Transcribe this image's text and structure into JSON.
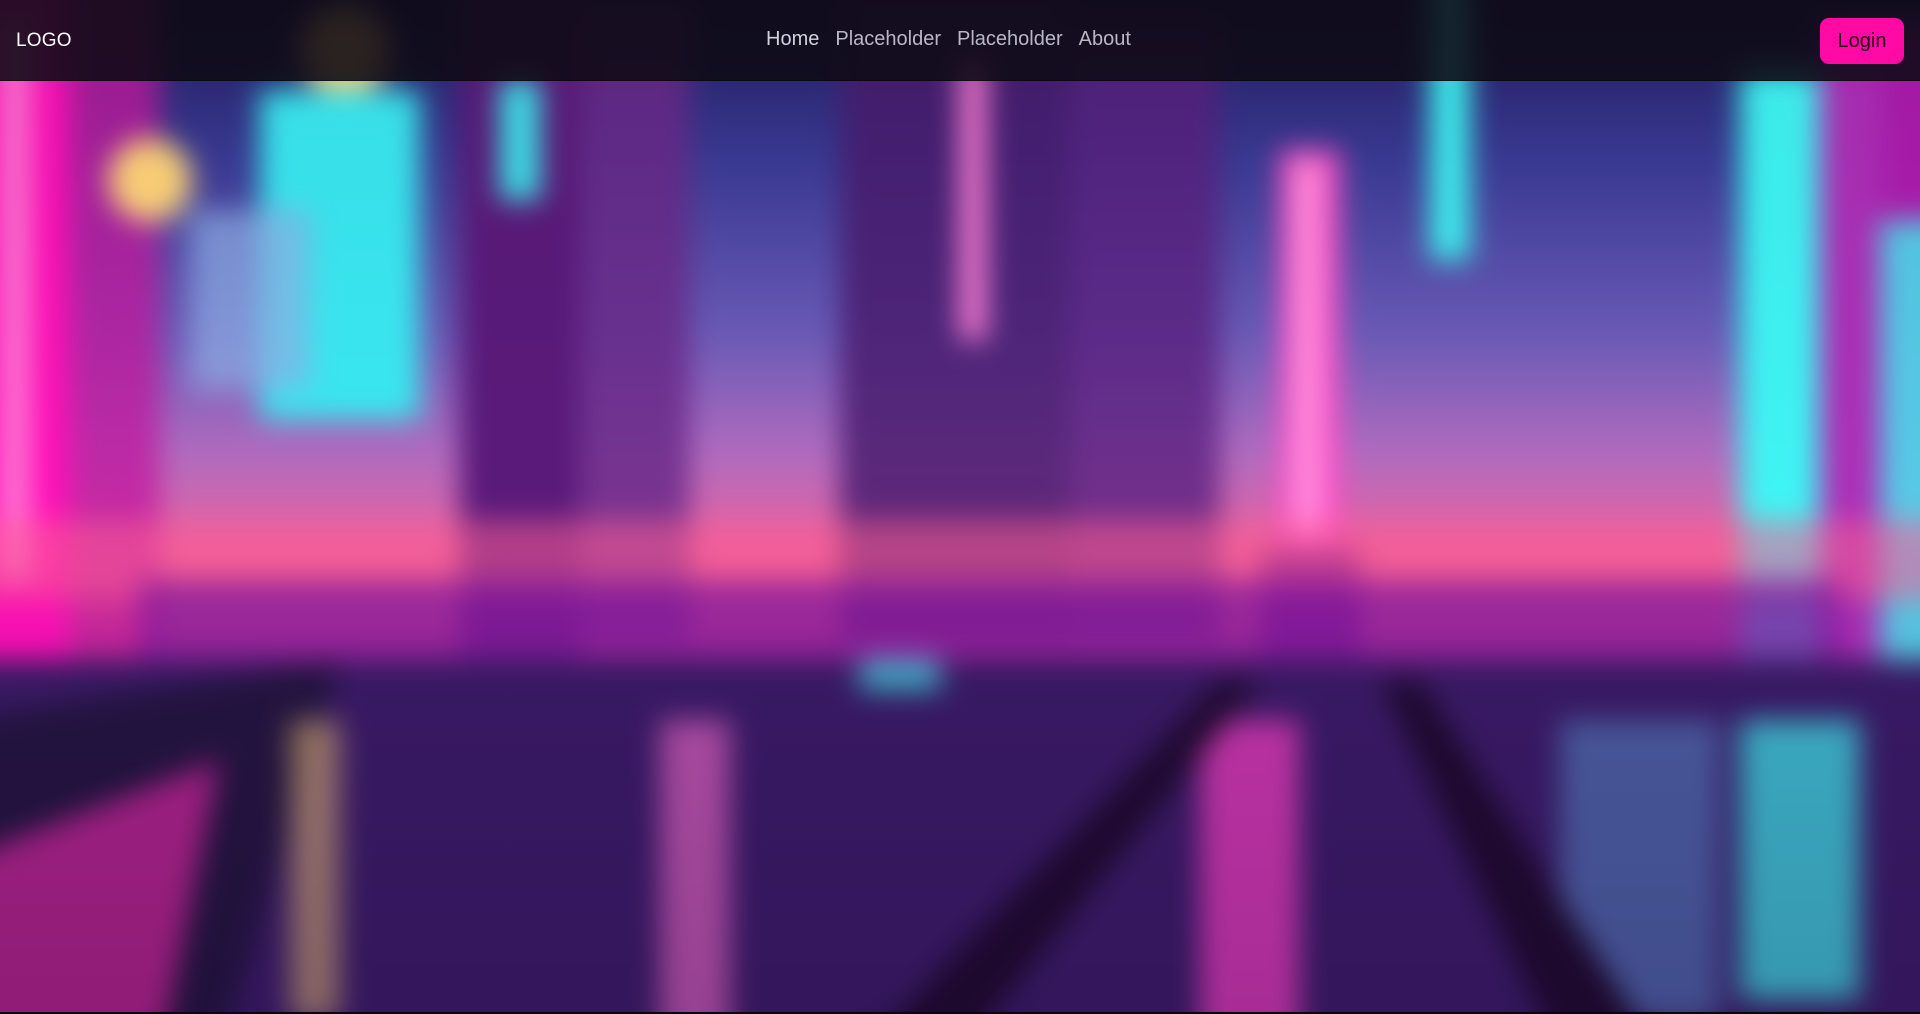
{
  "navbar": {
    "logo": "LOGO",
    "links": [
      {
        "label": "Home"
      },
      {
        "label": "Placeholder"
      },
      {
        "label": "Placeholder"
      },
      {
        "label": "About"
      }
    ],
    "login_label": "Login"
  },
  "colors": {
    "accent": "#ff0aa5",
    "navbar_bg": "#0e0a14",
    "nav_text": "#b8b8c4",
    "neon_pink": "#ff1eb4",
    "neon_cyan": "#3ff4f4"
  },
  "background": {
    "scene": "cyberpunk-city-image"
  }
}
